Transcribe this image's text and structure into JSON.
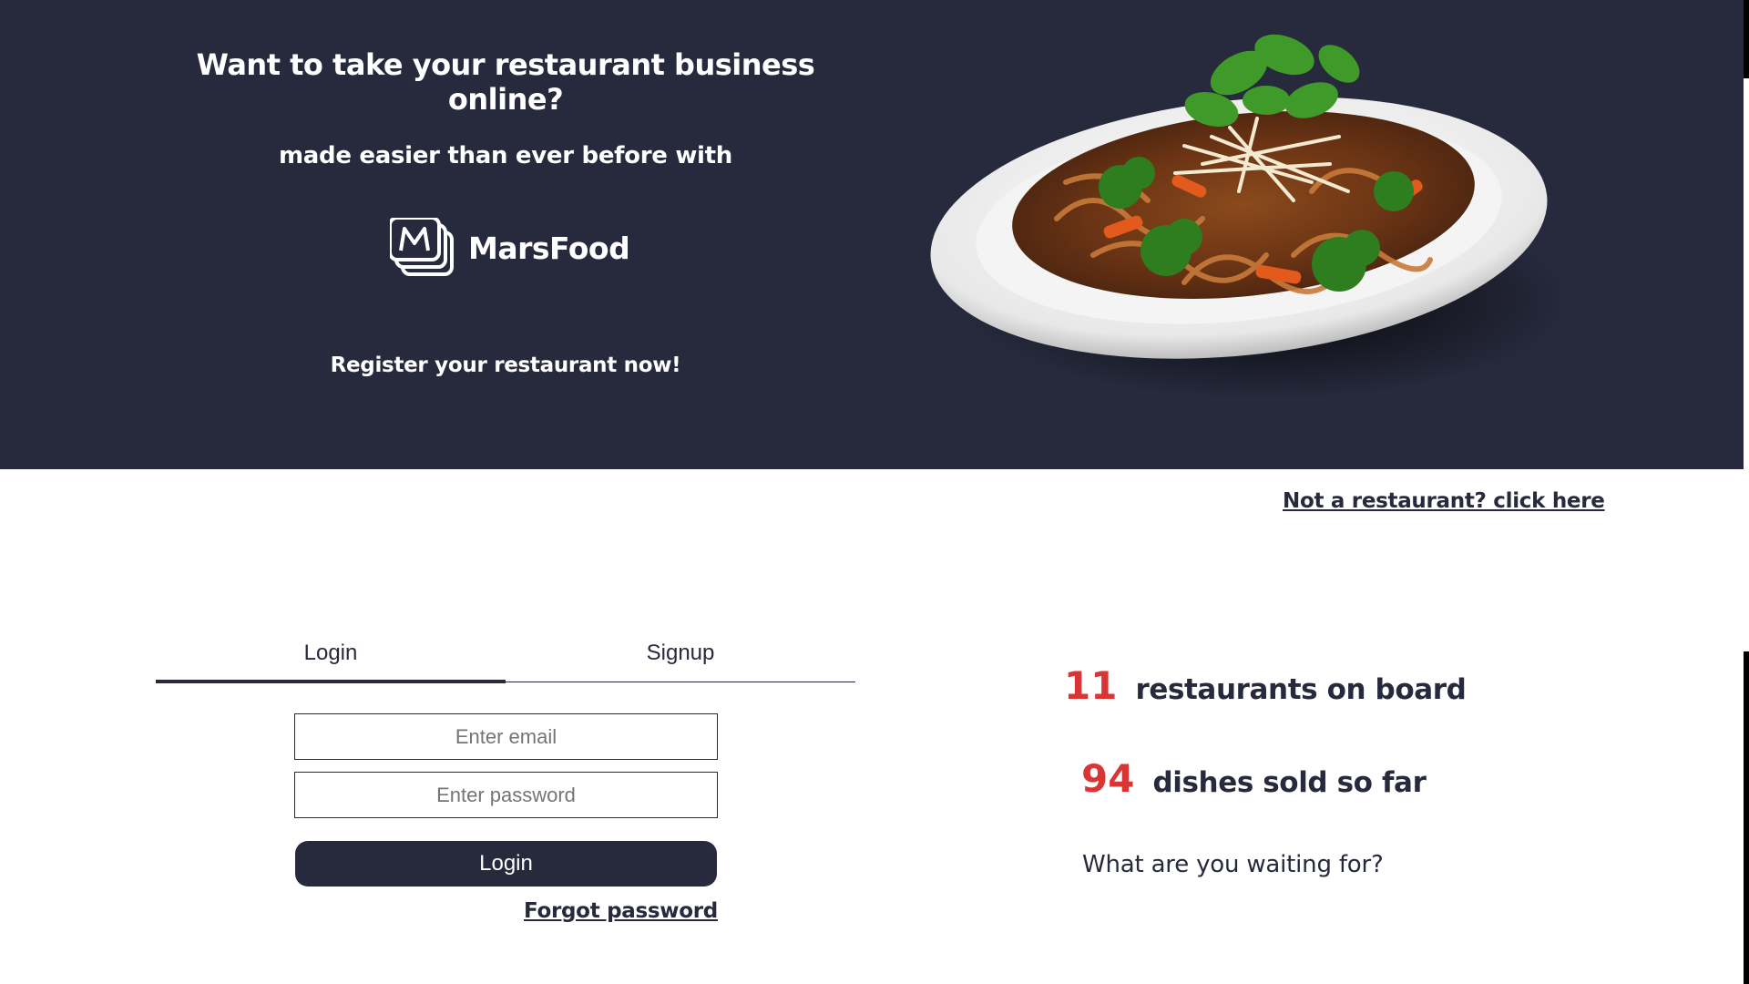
{
  "hero": {
    "title": "Want to take your restaurant business online?",
    "subtitle": "made easier than ever before with",
    "brand_name": "MarsFood",
    "brand_icon": "stacked-m-logo-icon",
    "register_text": "Register your restaurant now!",
    "background_color": "#272a3d",
    "image": "noodle-dish-plate"
  },
  "links": {
    "not_restaurant": "Not a restaurant? click here",
    "forgot_password": "Forgot password"
  },
  "tabs": [
    {
      "label": "Login",
      "active": true
    },
    {
      "label": "Signup",
      "active": false
    }
  ],
  "form": {
    "email_placeholder": "Enter email",
    "email_value": "",
    "password_placeholder": "Enter password",
    "password_value": "",
    "submit_label": "Login"
  },
  "stats": {
    "restaurants_count": "11",
    "restaurants_text": "restaurants on board",
    "dishes_count": "94",
    "dishes_text": "dishes sold so far",
    "cta": "What are you waiting for?",
    "accent_color": "#d93535"
  }
}
